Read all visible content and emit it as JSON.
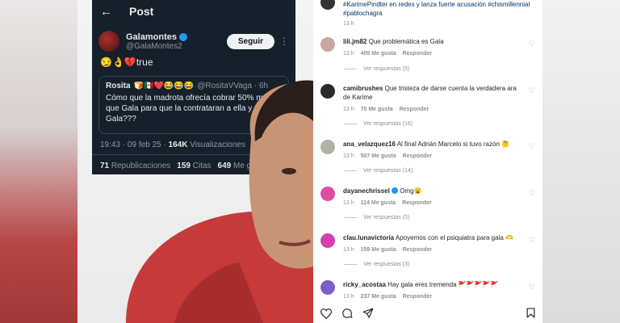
{
  "tweet": {
    "back_icon": "←",
    "header": "Post",
    "author_name": "Galamontes",
    "author_handle": "@GalaMontes2",
    "follow_label": "Seguir",
    "text": "😏👌💔true",
    "quote_name": "Rosita",
    "quote_emojis": "🍞🇲🇽❤️😂😂😂",
    "quote_handle": "@RositaVVaga · 6h",
    "quote_text": "Cómo que la madrota ofrecía cobrar 50% menos que Gala para que la contrataran a ella y no a Gala???",
    "time": "19:43 · 09 feb 25 · ",
    "views_count": "164K",
    "views_label": " Visualizaciones",
    "reposts_count": "71",
    "reposts_label": " Republicaciones",
    "quotes_count": "159",
    "quotes_label": " Citas",
    "likes_count": "649",
    "likes_label": " Me gust"
  },
  "caption": {
    "line1": "#KarimePindter en redes y lanza fuerte acusación #chismillennial",
    "line2": "#pablochagra",
    "time": "13 h"
  },
  "comments": [
    {
      "user": "lili.jm82",
      "text": "Que problemática es Gala",
      "time": "13 h",
      "likes": "409 Me gusta",
      "reply": "Responder",
      "view": "Ver respuestas (5)",
      "avatar_color": "#c9a7a0"
    },
    {
      "user": "camibrushes",
      "text": "Que tristeza de darse cuenta la verdadera ara de Karime",
      "time": "13 h",
      "likes": "70 Me gusta",
      "reply": "Responder",
      "view": "Ver respuestas (16)",
      "avatar_color": "#2b2b2b"
    },
    {
      "user": "ana_velazquez16",
      "text": "Al final Adrián Marcelo si tuvo razón 🤔",
      "time": "13 h",
      "likes": "507 Me gusta",
      "reply": "Responder",
      "view": "Ver respuestas (14)",
      "avatar_color": "#b5b0a5"
    },
    {
      "user": "dayanechrissel",
      "text": "Omg😮",
      "time": "13 h",
      "likes": "114 Me gusta",
      "reply": "Responder",
      "view": "Ver respuestas (5)",
      "avatar_color": "#e04ea0"
    },
    {
      "user": "clau.lunavictoria",
      "text": "Apoyemos con el psiquiatra para gala 🫶",
      "time": "13 h",
      "likes": "159 Me gusta",
      "reply": "Responder",
      "view": "Ver respuestas (3)",
      "avatar_color": "#d63fb0"
    },
    {
      "user": "ricky_acostaa",
      "text": "Hay gala eres tremenda 🚩🚩🚩🚩🚩",
      "time": "13 h",
      "likes": "237 Me gusta",
      "reply": "Responder",
      "view": "",
      "avatar_color": "#7b5fc9"
    }
  ],
  "icons": {
    "heart": "heart-icon",
    "comment": "comment-icon",
    "share": "share-icon",
    "save": "bookmark-icon"
  }
}
